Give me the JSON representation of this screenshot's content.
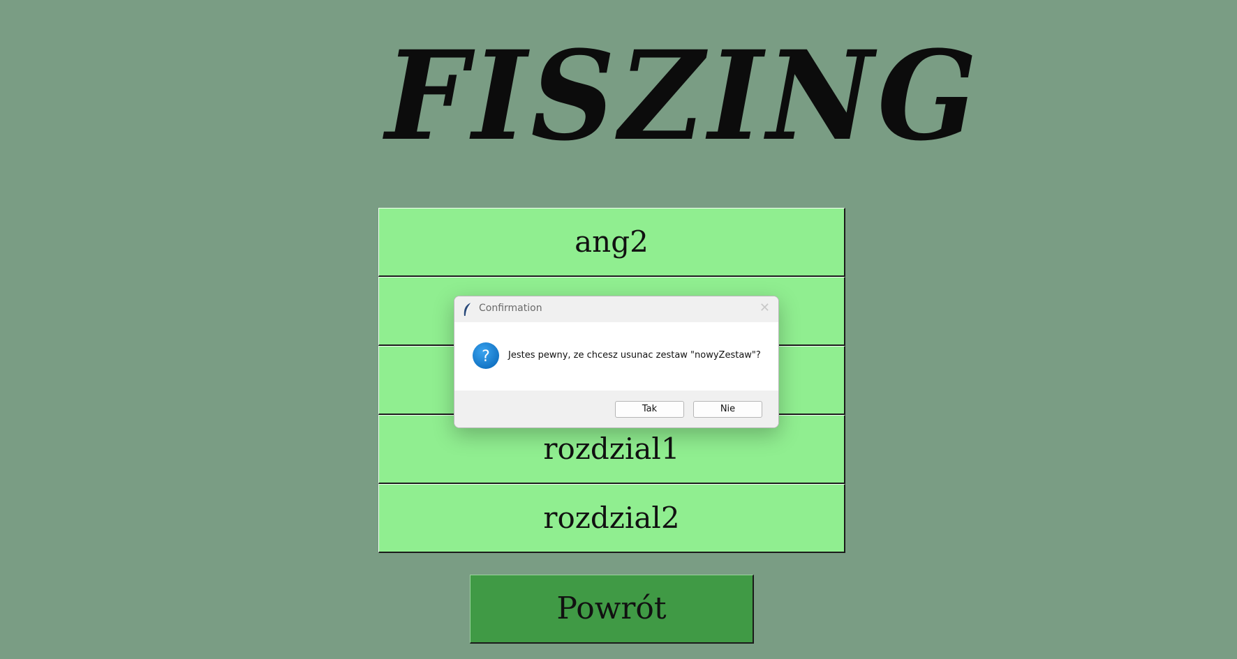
{
  "app": {
    "title": "FISZING"
  },
  "sets": [
    {
      "label": "ang2"
    },
    {
      "label": ""
    },
    {
      "label": ""
    },
    {
      "label": "rozdzial1"
    },
    {
      "label": "rozdzial2"
    }
  ],
  "back_button": {
    "label": "Powrót"
  },
  "dialog": {
    "title": "Confirmation",
    "message": "Jestes pewny, ze chcesz usunac zestaw \"nowyZestaw\"?",
    "yes_label": "Tak",
    "no_label": "Nie",
    "icons": {
      "window": "feather-icon",
      "close": "close-icon",
      "status": "question-icon"
    }
  },
  "colors": {
    "background": "#7a9d84",
    "set_button": "#90ee90",
    "back_button": "#409a45",
    "question_icon": "#1b86d6"
  }
}
